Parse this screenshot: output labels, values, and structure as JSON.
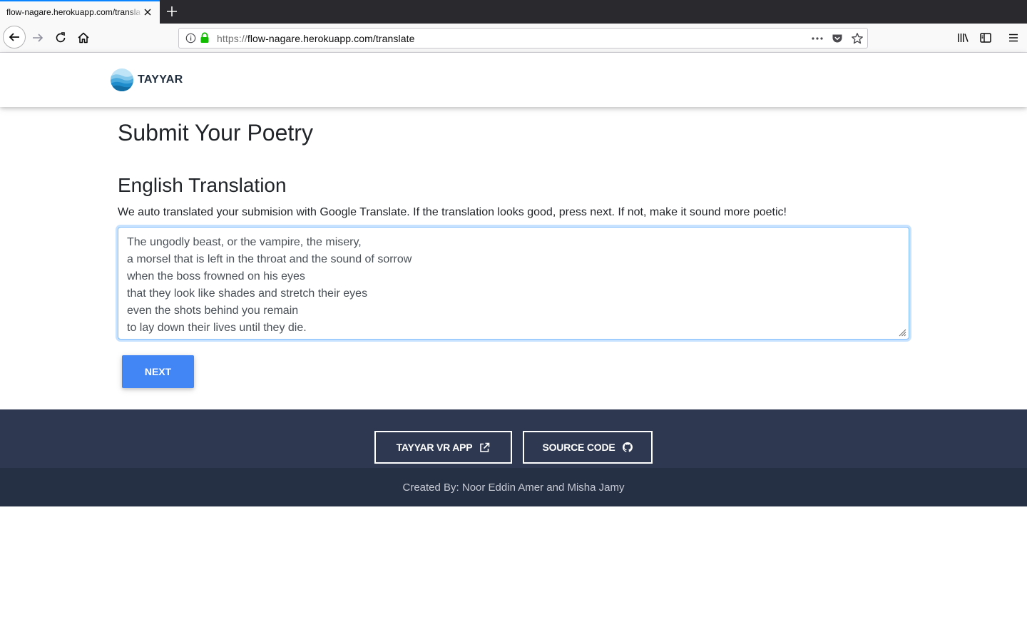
{
  "browser": {
    "tab_title": "flow-nagare.herokuapp.com/translate",
    "url_scheme": "https://",
    "url_rest": "flow-nagare.herokuapp.com/translate"
  },
  "header": {
    "brand": "TAYYAR"
  },
  "main": {
    "page_title": "Submit Your Poetry",
    "section_title": "English Translation",
    "description": "We auto translated your submision with Google Translate. If the translation looks good, press next. If not, make it sound more poetic!",
    "poem_lines": [
      "The ungodly beast, or the vampire, the misery,",
      "a morsel that is left in the throat and the sound of sorrow",
      "when the boss frowned on his eyes",
      "that they look like shades and stretch their eyes",
      "even the shots behind you remain",
      "to lay down their lives until they die."
    ],
    "next_label": "NEXT"
  },
  "footer": {
    "vr_app_label": "TAYYAR VR APP",
    "source_code_label": "SOURCE CODE",
    "credits": "Created By: Noor Eddin Amer and Misha Jamy"
  },
  "colors": {
    "primary_button": "#4285f4",
    "footer_bg": "#2e3951",
    "copyright_bg": "#263045",
    "focus_border": "#80bdff"
  },
  "icons": [
    "close-icon",
    "plus-icon",
    "back-arrow-icon",
    "forward-arrow-icon",
    "reload-icon",
    "home-icon",
    "info-icon",
    "lock-icon",
    "more-dots-icon",
    "pocket-icon",
    "star-icon",
    "library-icon",
    "sidebar-icon",
    "hamburger-menu-icon",
    "external-link-icon",
    "github-icon"
  ]
}
